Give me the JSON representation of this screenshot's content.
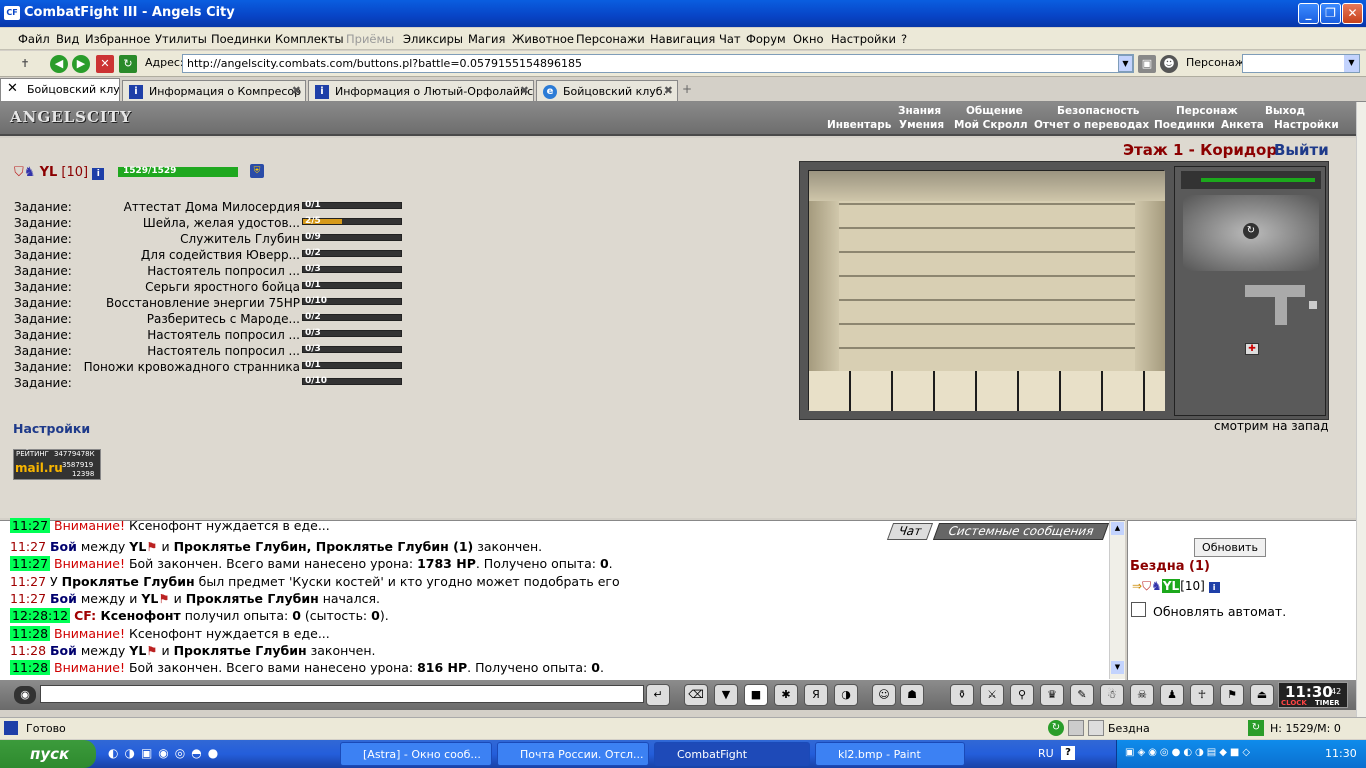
{
  "window": {
    "title": "CombatFight III - Angels City",
    "app_icon": "CF"
  },
  "menu": [
    "Файл",
    "Вид",
    "Избранное",
    "Утилиты",
    "Поединки",
    "Комплекты",
    "Приёмы",
    "Эликсиры",
    "Магия",
    "Животное",
    "Персонажи",
    "Навигация",
    "Чат",
    "Форум",
    "Окно",
    "Настройки",
    "?"
  ],
  "addressbar": {
    "label": "Адрес:",
    "url": "http://angelscity.combats.com/buttons.pl?battle=0.0579155154896185",
    "persona_label": "Персонаж:"
  },
  "tabs": [
    {
      "label": "Бойцовский клуб"
    },
    {
      "label": "Информация о Компресор"
    },
    {
      "label": "Информация о Лютый-Орфолайнс"
    },
    {
      "label": "Бойцовский клуб."
    }
  ],
  "game": {
    "logo": "ANGELSCITY",
    "nav_top": [
      "Знания",
      "Общение",
      "Безопасность",
      "Персонаж",
      "Выход"
    ],
    "nav_bottom": [
      "Инвентарь",
      "Умения",
      "Мой Скролл",
      "Отчет о переводах",
      "Поединки",
      "Анкета",
      "Настройки"
    ],
    "player": {
      "name": "YL",
      "level": "[10]",
      "hp": "1529/1529",
      "hp_fraction": 1.0
    },
    "location": "Этаж 1 - Коридор",
    "exit_label": "Выйти",
    "facing": "смотрим на запад",
    "settings_link": "Настройки",
    "rating": {
      "title": "РЕЙТИНГ",
      "id": "34779478К",
      "brand": "mail.ru",
      "n1": "3587919",
      "n2": "12398"
    },
    "task_label": "Задание:",
    "tasks": [
      {
        "name": "Аттестат Дома Милосердия",
        "progress": "0/1",
        "fraction": 0
      },
      {
        "name": "Шейла, желая удостов...",
        "progress": "2/5",
        "fraction": 0.4
      },
      {
        "name": "Служитель Глубин",
        "progress": "0/9",
        "fraction": 0
      },
      {
        "name": "Для содействия Юверр...",
        "progress": "0/2",
        "fraction": 0
      },
      {
        "name": "Настоятель попросил ...",
        "progress": "0/3",
        "fraction": 0
      },
      {
        "name": "Серьги яростного бойца",
        "progress": "0/1",
        "fraction": 0
      },
      {
        "name": "Восстановление энергии 75HP",
        "progress": "0/10",
        "fraction": 0
      },
      {
        "name": "Разберитесь с Мароде...",
        "progress": "0/2",
        "fraction": 0
      },
      {
        "name": "Настоятель попросил ...",
        "progress": "0/3",
        "fraction": 0
      },
      {
        "name": "Настоятель попросил ...",
        "progress": "0/3",
        "fraction": 0
      },
      {
        "name": "Поножи кровожадного странника",
        "progress": "0/1",
        "fraction": 0
      },
      {
        "name": "",
        "progress": "0/10",
        "fraction": 0
      }
    ]
  },
  "chat": {
    "tab_chat": "Чат",
    "tab_system": "Системные сообщения",
    "lines": [
      {
        "time": "11:27",
        "type": "warn",
        "parts": [
          "Внимание!",
          " Ксенофонт нуждается в еде..."
        ]
      },
      {
        "time": "11:27",
        "type": "fight",
        "parts": [
          "Бой",
          " между ",
          "YL",
          " и ",
          "Проклятье Глубин, Проклятье Глубин (1)",
          " закончен."
        ]
      },
      {
        "time": "11:27",
        "type": "warn",
        "parts": [
          "Внимание!",
          " Бой закончен. Всего вами нанесено урона: ",
          "1783 HP",
          ". Получено опыта: ",
          "0",
          "."
        ]
      },
      {
        "time": "11:27",
        "type": "plain",
        "parts": [
          " У ",
          "Проклятье Глубин",
          " был предмет 'Куски костей' и кто угодно может подобрать его"
        ]
      },
      {
        "time": "11:27",
        "type": "fight2",
        "parts": [
          "Бой",
          " между и ",
          "YL",
          " и ",
          "Проклятье Глубин",
          " начался."
        ]
      },
      {
        "time": "12:28:12",
        "type": "cf",
        "parts": [
          "CF:",
          " Ксенофонт",
          " получил опыта: ",
          "0",
          " (сытость: ",
          "0",
          ")."
        ]
      },
      {
        "time": "11:28",
        "type": "warn",
        "parts": [
          "Внимание!",
          " Ксенофонт нуждается в еде..."
        ]
      },
      {
        "time": "11:28",
        "type": "fight3",
        "parts": [
          "Бой",
          " между ",
          "YL",
          " и ",
          "Проклятье Глубин",
          " закончен."
        ]
      },
      {
        "time": "11:28",
        "type": "warn",
        "parts": [
          "Внимание!",
          " Бой закончен. Всего вами нанесено урона: ",
          "816 HP",
          ". Получено опыта: ",
          "0",
          "."
        ]
      }
    ]
  },
  "rightpane": {
    "refresh": "Обновить",
    "room": "Бездна (1)",
    "member": "YL",
    "member_level": "[10]",
    "auto": "Обновлять автомат."
  },
  "clock": {
    "time": "11:30",
    "sec": "42",
    "l1": "CLOCK",
    "l2": "TIMER"
  },
  "status": {
    "left": "Готово",
    "zone": "Бездна",
    "hp": "Н: 1529/М: 0"
  },
  "taskbar": {
    "start": "пуск",
    "tasks": [
      "[Astra] - Окно сооб...",
      "Почта России. Отсл...",
      "CombatFight",
      "kl2.bmp - Paint"
    ],
    "lang": "RU",
    "time": "11:30"
  }
}
